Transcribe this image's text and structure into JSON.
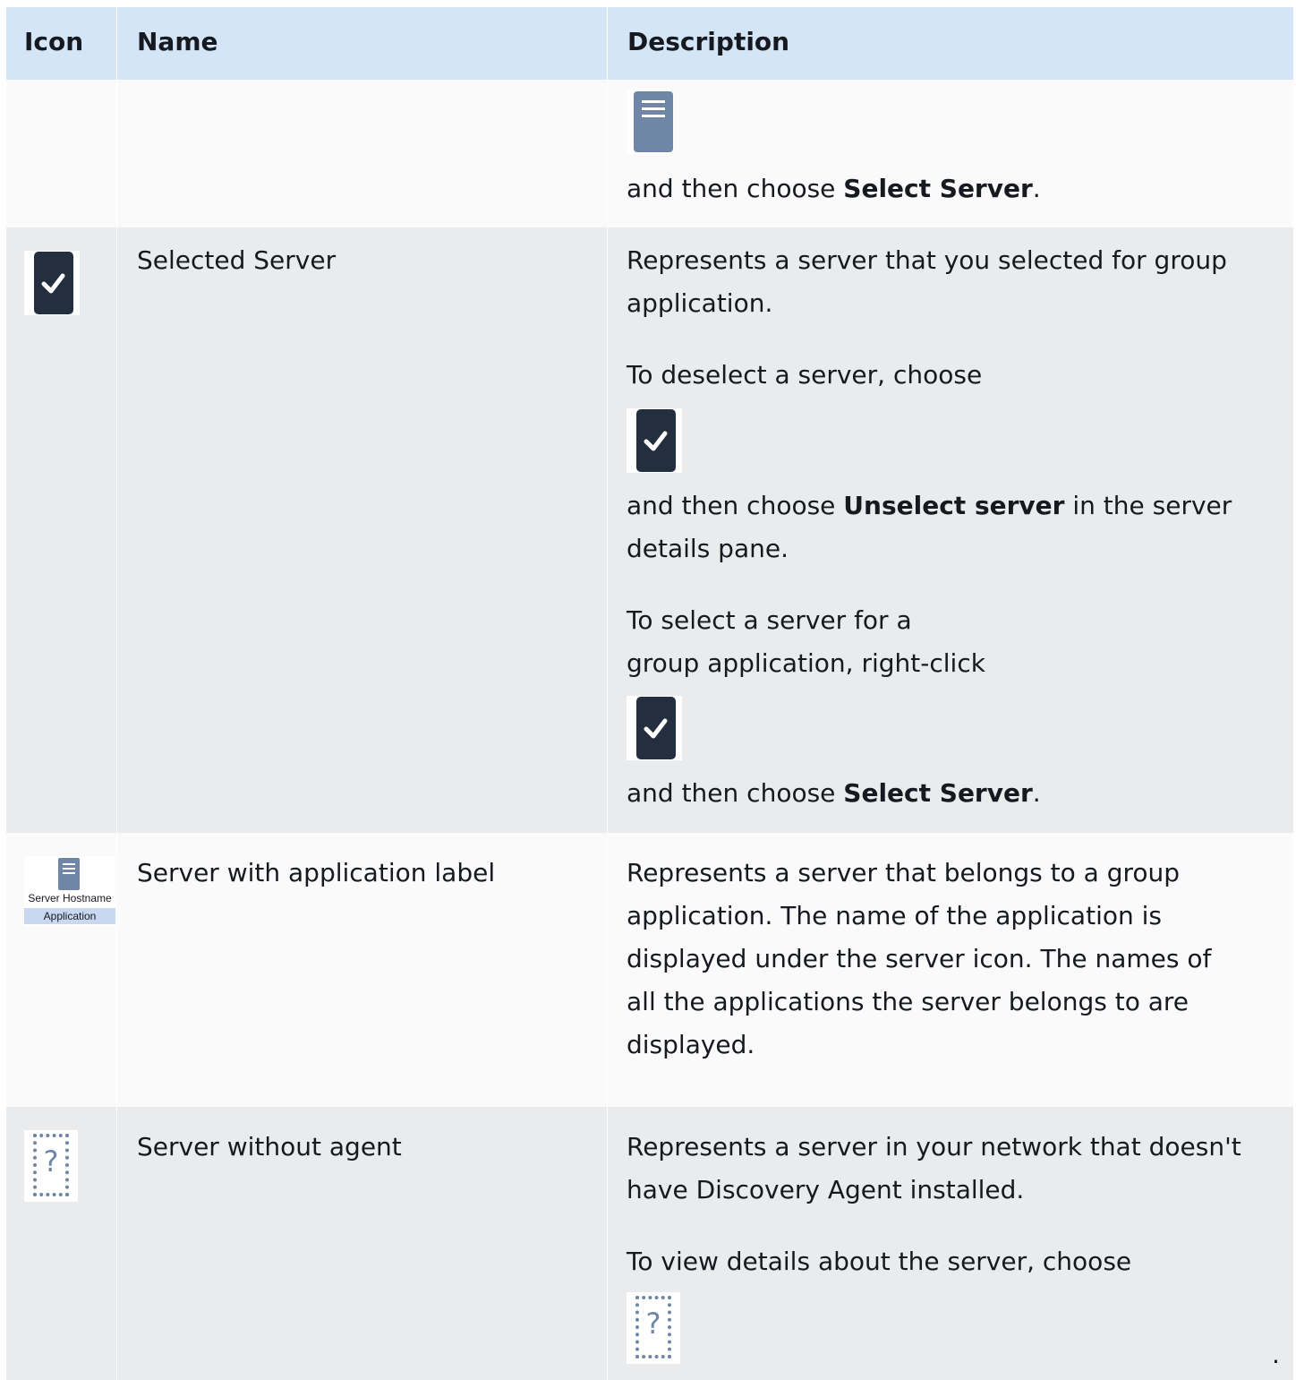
{
  "table": {
    "headers": {
      "icon": "Icon",
      "name": "Name",
      "description": "Description"
    },
    "rows": [
      {
        "name": "",
        "desc": {
          "line1_prefix": "and then choose ",
          "line1_bold": "Select Server",
          "line1_suffix": "."
        }
      },
      {
        "name": "Selected Server",
        "desc": {
          "p1_line1": "Represents a server that you selected for group",
          "p1_line2": "application.",
          "p2_line1": "To deselect a server, choose",
          "p2_line2_prefix": "and then choose ",
          "p2_line2_bold": "Unselect server",
          "p2_line2_suffix": " in the server",
          "p2_line3": "details pane.",
          "p3_line1": "To select a server for a",
          "p3_line2": "group application, right-click",
          "p3_line3_prefix": "and then choose ",
          "p3_line3_bold": "Select Server",
          "p3_line3_suffix": "."
        }
      },
      {
        "name": "Server with application label",
        "icon": {
          "host": "Server Hostname",
          "label": "Application"
        },
        "desc": {
          "line1": "Represents a server that belongs to a group",
          "line2": "application. The name of the application is",
          "line3": "displayed under the server icon. The names of",
          "line4": "all the applications the server belongs to are",
          "line5": "displayed."
        }
      },
      {
        "name": "Server without agent",
        "icon": {
          "mark": "?"
        },
        "desc": {
          "line1": "Represents a server in your network that doesn't",
          "line2": "have Discovery Agent installed.",
          "line3": "To view details about the server, choose",
          "trailing": "."
        }
      }
    ]
  },
  "icons": {
    "server": "server-icon",
    "selected": "checked-server-icon",
    "app_server": "server-with-application-label-icon",
    "no_agent": "server-without-agent-icon"
  },
  "colors": {
    "header_bg": "#d3e5f7",
    "row_light": "#fafafa",
    "row_dark": "#eaebed",
    "server_blue": "#6f86a6",
    "check_dark": "#232f3e"
  }
}
